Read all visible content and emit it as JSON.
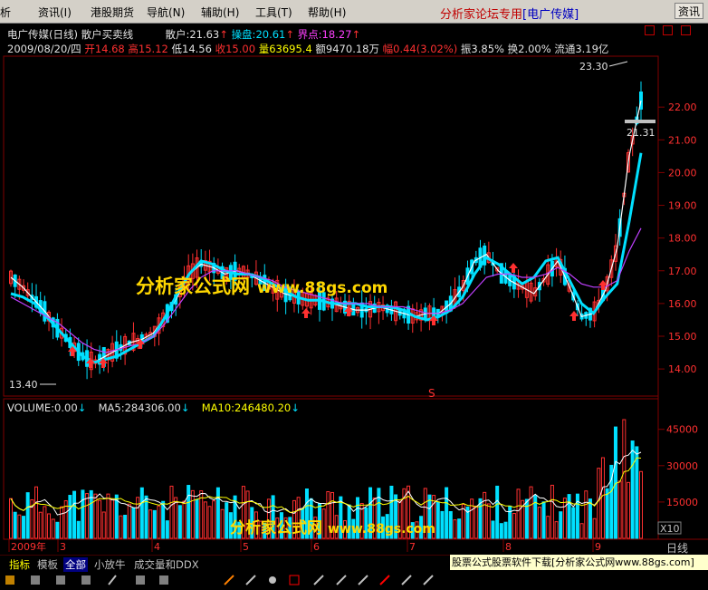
{
  "menu": {
    "items": [
      "析",
      "资讯(I)",
      "港股期货",
      "导航(N)",
      "辅助(H)",
      "工具(T)",
      "帮助(H)"
    ],
    "right_title": "分析家论坛专用",
    "stock_tag": "[电广传媒]",
    "info_button": "资讯"
  },
  "indicator_header": {
    "stock": "电广传媒(日线)",
    "indicator": "散户买卖线",
    "sanhu_label": "散户:",
    "sanhu_value": "21.63",
    "caopan_label": "操盘:",
    "caopan_value": "20.61",
    "jiedian_label": "界点:",
    "jiedian_value": "18.27"
  },
  "quote_line": {
    "date": "2009/08/20/四",
    "open_label": "开",
    "open": "14.68",
    "high_label": "高",
    "high": "15.12",
    "low_label": "低",
    "low": "14.56",
    "close_label": "收",
    "close": "15.00",
    "vol_label": "量",
    "vol": "63695.4",
    "amount_label": "额",
    "amount": "9470.18万",
    "change_label": "幅",
    "change": "0.44(3.02%)",
    "amplitude_label": "振",
    "amplitude": "3.85%",
    "turnover_label": "换",
    "turnover": "2.00%",
    "float_label": "流通",
    "float": "3.19亿"
  },
  "price_axis": {
    "ticks": [
      "22.00",
      "21.00",
      "20.00",
      "19.00",
      "18.00",
      "17.00",
      "16.00",
      "15.00",
      "14.00"
    ],
    "high_marker": "23.30",
    "low_marker": "13.40",
    "last_marker": "21.31"
  },
  "volume_header": {
    "volume_label": "VOLUME:",
    "volume_value": "0.00",
    "ma5_label": "MA5:",
    "ma5_value": "284306.00",
    "ma10_label": "MA10:",
    "ma10_value": "246480.20"
  },
  "volume_axis": {
    "ticks": [
      "45000",
      "30000",
      "15000"
    ],
    "unit": "X10"
  },
  "date_axis": {
    "labels": [
      "2009年",
      "3",
      "4",
      "5",
      "6",
      "7",
      "8",
      "9"
    ]
  },
  "period": "日线",
  "watermark": {
    "text": "分析家公式网",
    "url": "www.88gs.com"
  },
  "bottom_tabs": [
    "指标",
    "模板",
    "全部",
    "小放牛",
    "成交量和DDX"
  ],
  "download_bar": "股票公式股票软件下载[分析家公式网www.88gs.com]",
  "s_marker": "S",
  "colors": {
    "up": "#ff3030",
    "down": "#00e0ff",
    "ma_white": "#ffffff",
    "ma_cyan": "#00e0ff",
    "ma_magenta": "#c040ff",
    "ma_yellow": "#ffff00"
  },
  "chart_data": {
    "type": "line",
    "ylim": [
      13.2,
      23.5
    ],
    "series": [
      {
        "name": "散户",
        "values": [
          16.8,
          16.5,
          16.1,
          15.7,
          15.2,
          14.8,
          14.4,
          14.2,
          14.4,
          14.6,
          14.8,
          14.9,
          15.1,
          15.6,
          16.2,
          16.9,
          17.2,
          17.1,
          16.9,
          17.0,
          16.9,
          16.7,
          16.5,
          16.3,
          16.2,
          16.1,
          16.1,
          16.0,
          15.9,
          15.8,
          15.8,
          15.9,
          15.8,
          15.7,
          15.6,
          15.7,
          15.7,
          16.0,
          16.5,
          17.3,
          17.5,
          17.0,
          16.7,
          16.5,
          16.3,
          16.8,
          17.3,
          16.5,
          15.6,
          15.7,
          16.4,
          17.7,
          20.5,
          22.2
        ]
      },
      {
        "name": "操盘",
        "values": [
          16.3,
          16.2,
          16.0,
          15.6,
          15.2,
          14.8,
          14.4,
          14.2,
          14.3,
          14.4,
          14.6,
          14.8,
          15.0,
          15.6,
          16.3,
          16.9,
          17.3,
          17.2,
          17.0,
          16.9,
          16.9,
          16.8,
          16.6,
          16.4,
          16.2,
          16.1,
          16.1,
          16.0,
          16.0,
          16.0,
          15.9,
          15.9,
          15.9,
          15.8,
          15.6,
          15.5,
          15.6,
          15.8,
          16.2,
          16.9,
          17.4,
          17.2,
          16.9,
          16.6,
          16.8,
          17.3,
          17.4,
          16.7,
          16.0,
          15.7,
          16.2,
          16.6,
          18.5,
          20.6
        ]
      },
      {
        "name": "界点",
        "values": [
          16.2,
          16.0,
          15.8,
          15.6,
          15.4,
          15.1,
          14.8,
          14.6,
          14.5,
          14.6,
          14.7,
          14.8,
          15.0,
          15.4,
          15.9,
          16.4,
          16.8,
          17.0,
          17.0,
          17.0,
          16.9,
          16.8,
          16.7,
          16.5,
          16.4,
          16.3,
          16.2,
          16.1,
          16.0,
          16.0,
          16.0,
          15.9,
          15.9,
          15.9,
          15.8,
          15.7,
          15.7,
          15.8,
          16.0,
          16.4,
          16.8,
          16.9,
          16.9,
          16.8,
          16.8,
          16.9,
          17.1,
          16.9,
          16.6,
          16.5,
          16.5,
          16.7,
          17.6,
          18.3
        ]
      }
    ]
  }
}
